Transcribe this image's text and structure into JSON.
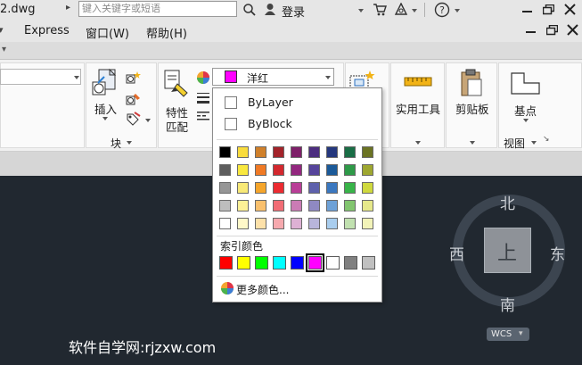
{
  "titlebar": {
    "file_name": "2.dwg",
    "search_placeholder": "键入关键字或短语",
    "login_label": "登录"
  },
  "menubar": {
    "items": [
      {
        "label": "Express"
      },
      {
        "label": "窗口(W)"
      },
      {
        "label": "帮助(H)"
      }
    ]
  },
  "ribbon": {
    "insert_label": "插入",
    "block_panel_label": "块",
    "properties_label_1": "特性",
    "properties_label_2": "匹配",
    "color_value": "洋红",
    "utilities_label": "实用工具",
    "clipboard_label": "剪贴板",
    "basepoint_label": "基点",
    "view_panel_label": "视图"
  },
  "color_dropdown": {
    "bylayer_label": "ByLayer",
    "byblock_label": "ByBlock",
    "index_color_label": "索引颜色",
    "more_colors_label": "更多颜色...",
    "grid": [
      [
        "#000000",
        "#f9dc3d",
        "#d0802b",
        "#a3232a",
        "#7e2069",
        "#4c2d7f",
        "#25387e",
        "#1a6e46",
        "#6b7323"
      ],
      [
        "#5e5e5e",
        "#f9e83f",
        "#f07a25",
        "#d3282e",
        "#93277f",
        "#56449b",
        "#1b5a99",
        "#2e9a48",
        "#9ea730"
      ],
      [
        "#969696",
        "#f8e977",
        "#f5a52b",
        "#ec2b31",
        "#b93e97",
        "#5e61ac",
        "#3b78c0",
        "#38b449",
        "#cfd93e"
      ],
      [
        "#bdbdbd",
        "#fdf196",
        "#f9c06d",
        "#f16c75",
        "#ca7bb5",
        "#8f89c2",
        "#6ea1d7",
        "#82c56f",
        "#e6e88a"
      ],
      [
        "#ffffff",
        "#fff8c9",
        "#fde1a9",
        "#f6a9ae",
        "#ddb1d4",
        "#b8b5db",
        "#a9cdee",
        "#c1e1b0",
        "#f2f3b8"
      ]
    ],
    "index_colors": [
      "#ff0000",
      "#ffff00",
      "#00ff00",
      "#00ffff",
      "#0000ff",
      "#ff00ff",
      "#ffffff",
      "#808080",
      "#c0c0c0"
    ],
    "selected_index_color": "#ff00ff"
  },
  "viewcube": {
    "north": "北",
    "south": "南",
    "east": "东",
    "west": "西",
    "face": "上",
    "wcs_label": "WCS"
  },
  "watermark": "软件自学网:rjzxw.com"
}
